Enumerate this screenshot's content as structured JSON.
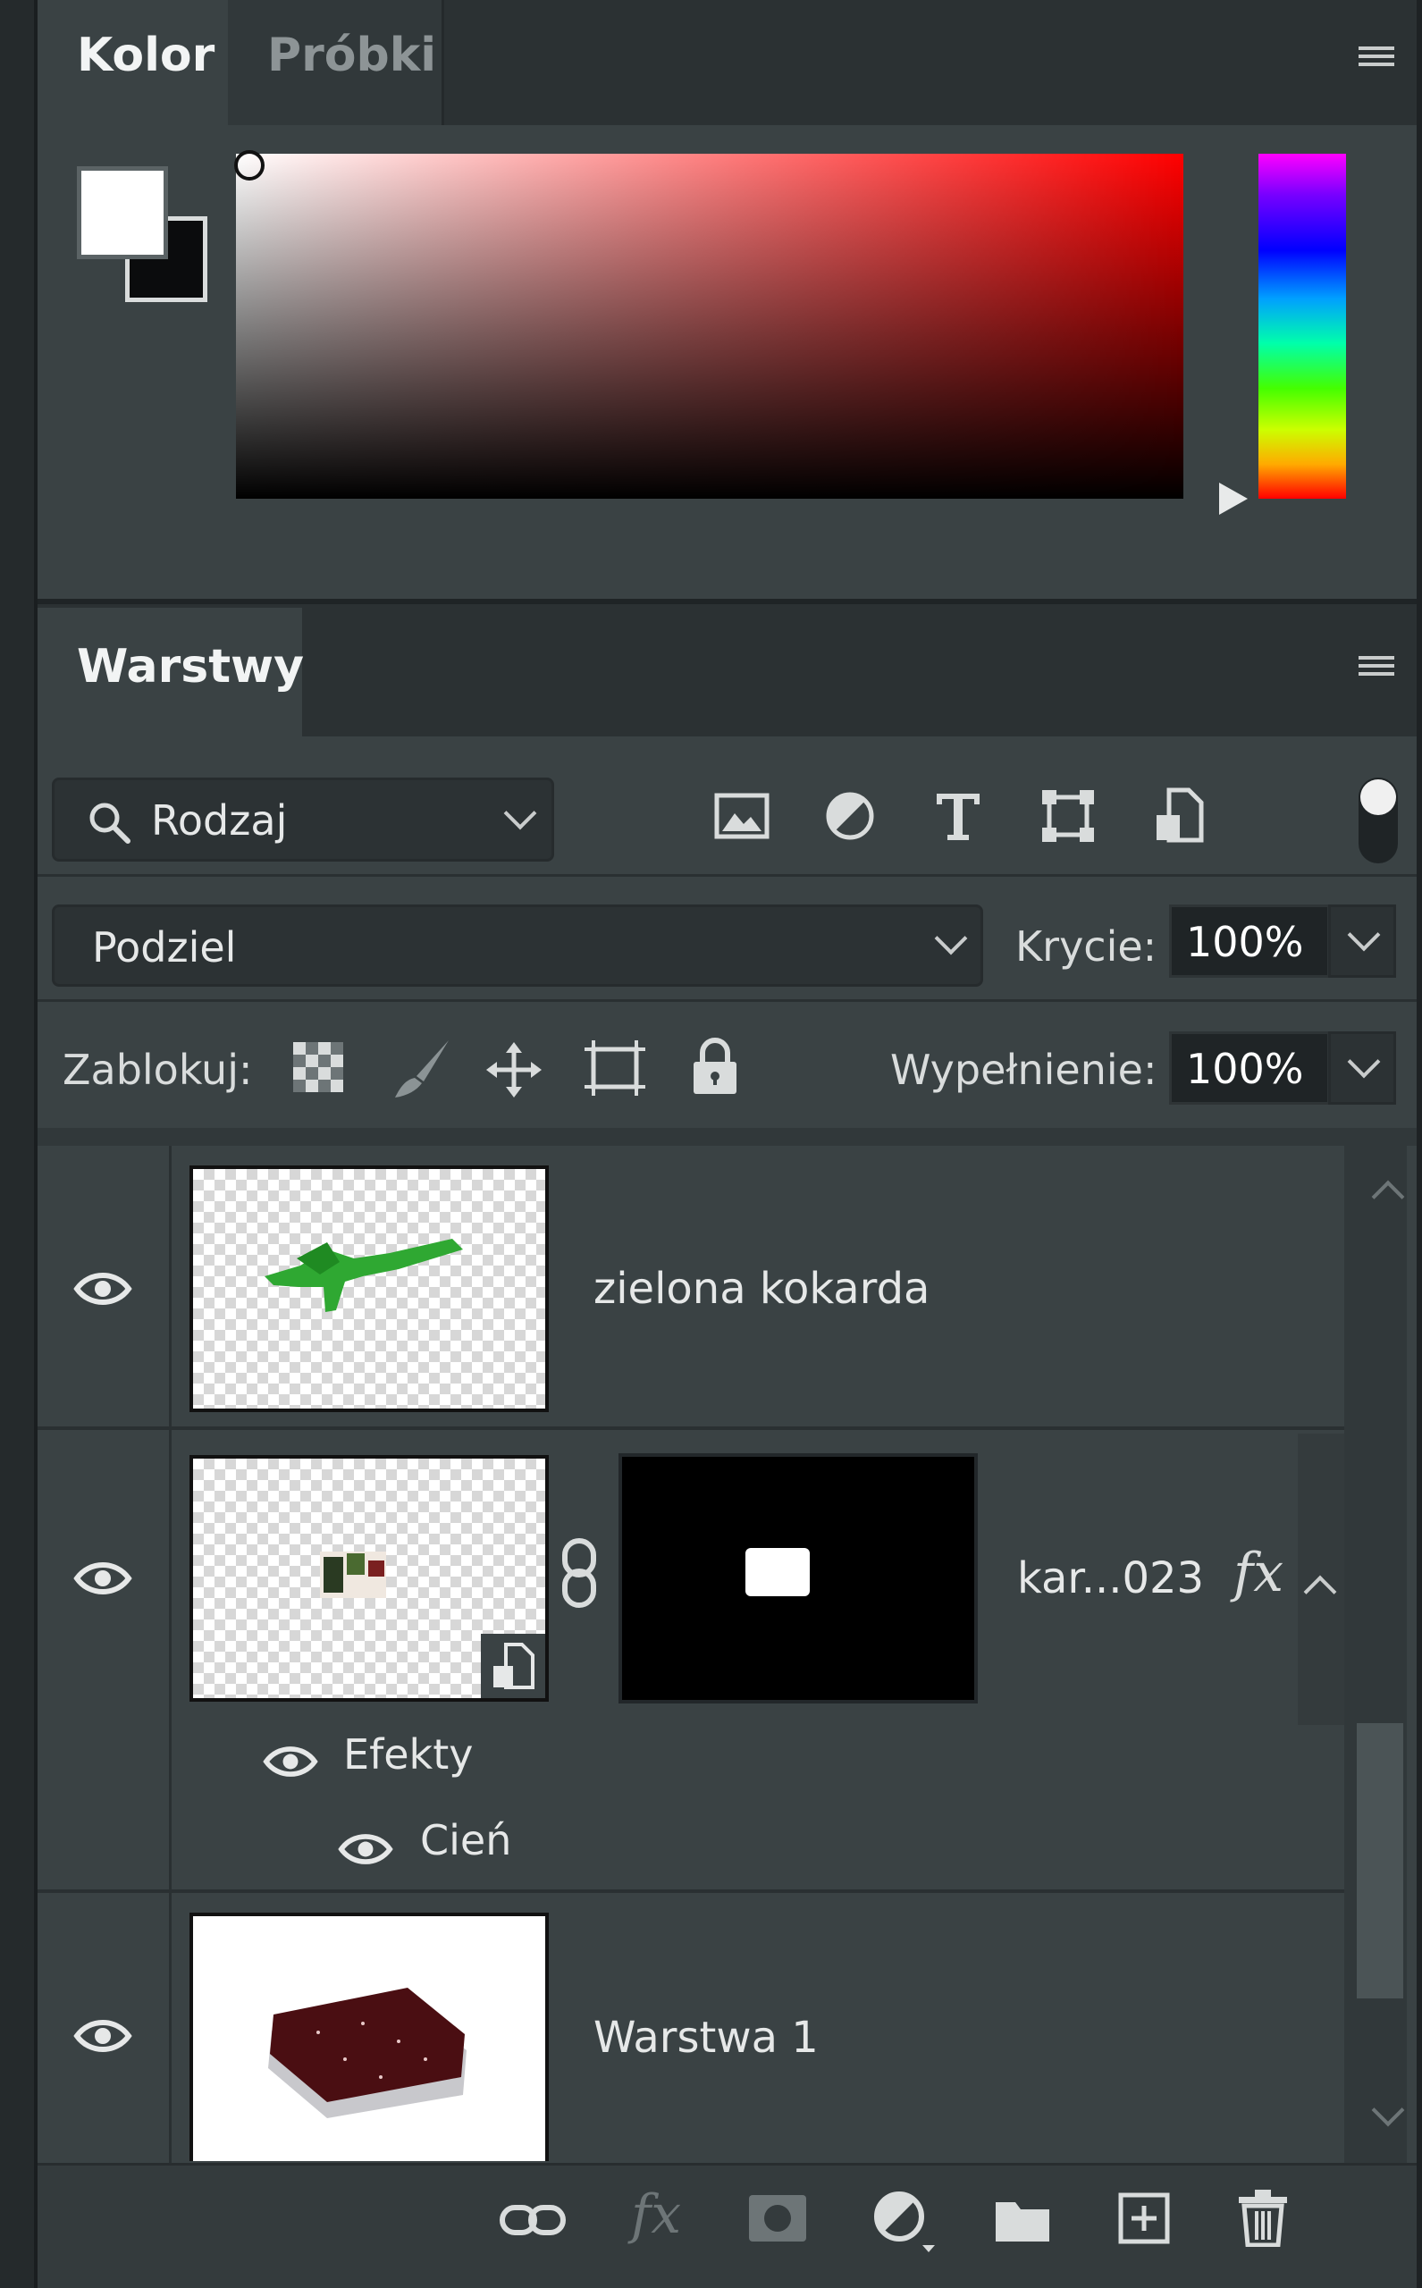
{
  "color_panel": {
    "tabs": [
      {
        "label": "Kolor",
        "active": true
      },
      {
        "label": "Próbki",
        "active": false
      }
    ],
    "foreground_color": "#ffffff",
    "background_color": "#0b0c0d",
    "hue_color": "#ff0000"
  },
  "layers_panel": {
    "tab_label": "Warstwy",
    "filter": {
      "label": "Rodzaj"
    },
    "filter_icons": [
      "image-filter-icon",
      "adjustment-filter-icon",
      "type-filter-icon",
      "shape-filter-icon",
      "smart-object-filter-icon"
    ],
    "blend_mode": "Podziel",
    "opacity": {
      "label": "Krycie:",
      "value": "100%"
    },
    "lock": {
      "label": "Zablokuj:"
    },
    "fill": {
      "label": "Wypełnienie:",
      "value": "100%"
    },
    "layers": [
      {
        "name": "zielona kokarda",
        "visible": true
      },
      {
        "name": "kar...023",
        "visible": true,
        "fx": "fx",
        "effects_label": "Efekty",
        "effect": "Cień"
      },
      {
        "name": "Warstwa 1",
        "visible": true
      }
    ],
    "footer_icons": [
      "link-layers-icon",
      "fx-icon",
      "mask-icon",
      "adjustment-icon",
      "group-icon",
      "new-layer-icon",
      "delete-icon"
    ]
  }
}
